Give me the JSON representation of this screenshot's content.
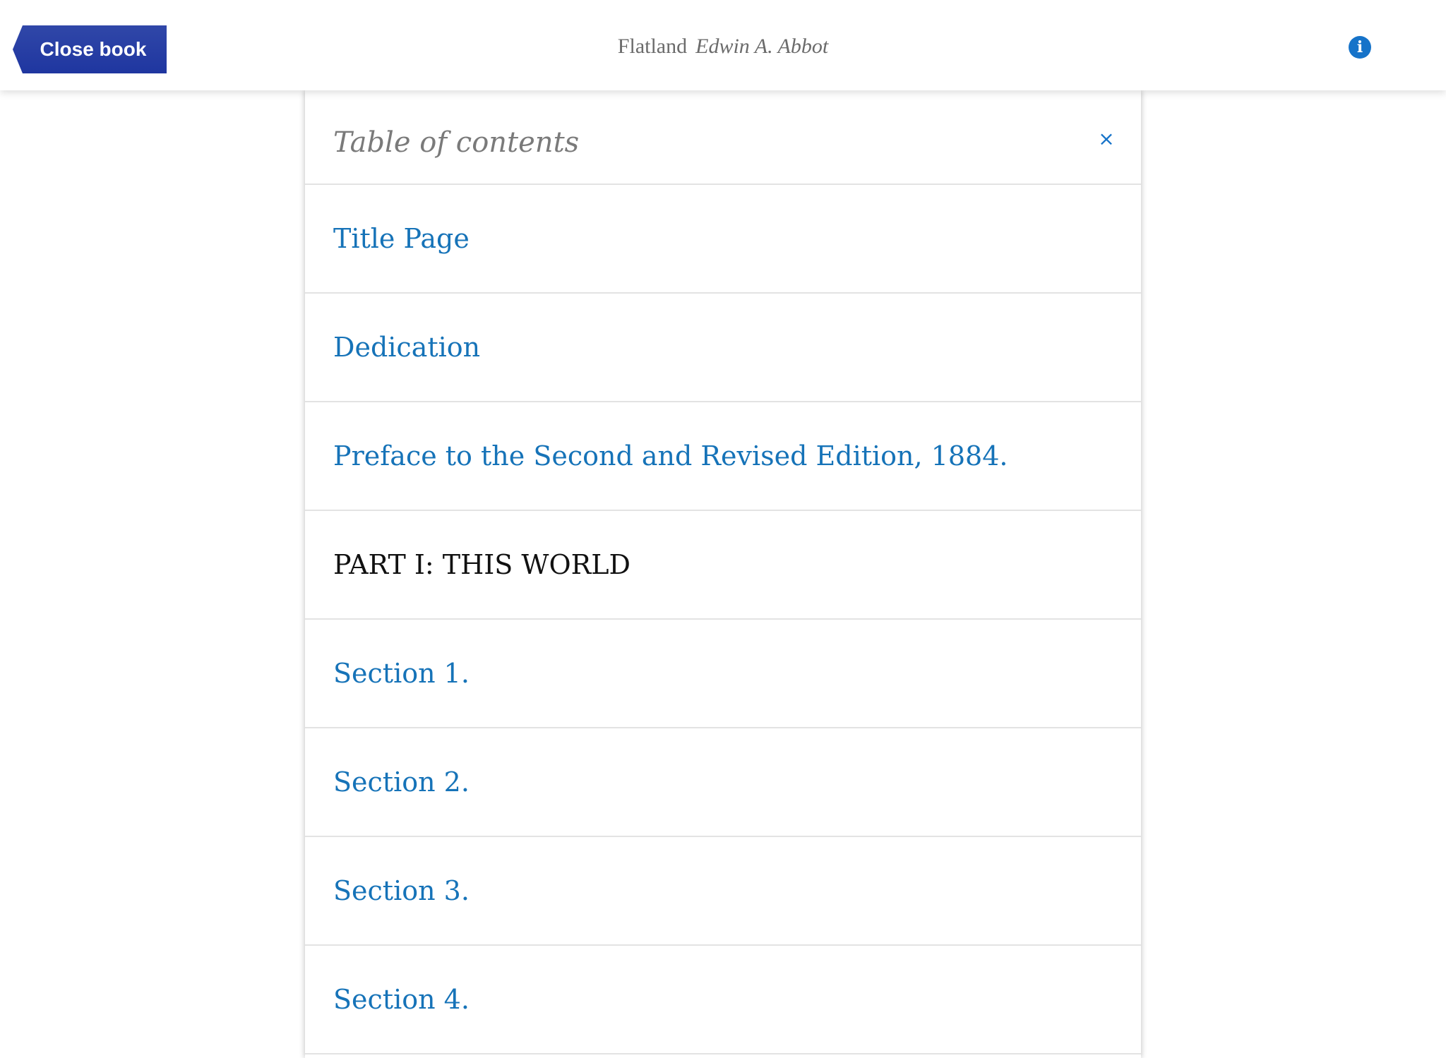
{
  "header": {
    "close_label": "Close book",
    "book_title": "Flatland",
    "author": "Edwin A. Abbot",
    "info_icon": "info-icon"
  },
  "toc": {
    "title": "Table of contents",
    "close_glyph": "×",
    "items": [
      {
        "label": "Title Page",
        "kind": "link"
      },
      {
        "label": "Dedication",
        "kind": "link"
      },
      {
        "label": "Preface to the Second and Revised Edition, 1884.",
        "kind": "link"
      },
      {
        "label": "PART I: THIS WORLD",
        "kind": "heading"
      },
      {
        "label": "Section 1.",
        "kind": "link"
      },
      {
        "label": "Section 2.",
        "kind": "link"
      },
      {
        "label": "Section 3.",
        "kind": "link"
      },
      {
        "label": "Section 4.",
        "kind": "link"
      }
    ]
  },
  "colors": {
    "accent": "#1673b8",
    "close_button": "#2a40a5",
    "heading_text": "#111111",
    "muted_text": "#7a7a7a"
  }
}
